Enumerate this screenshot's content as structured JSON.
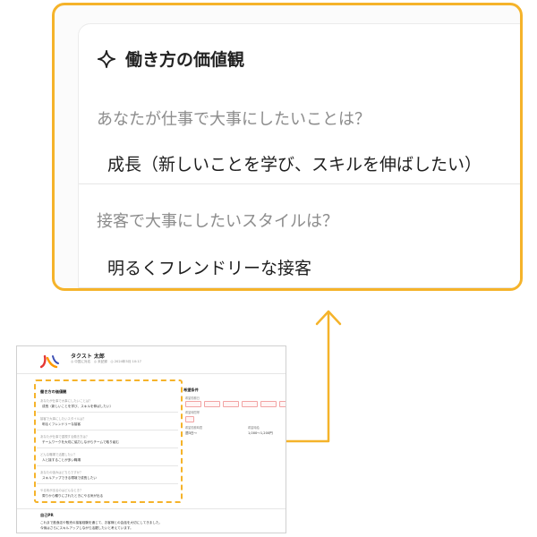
{
  "zoom": {
    "title": "働き方の価値観",
    "icon": "sparkle-icon",
    "q1": "あなたが仕事で大事にしたいことは？",
    "a1": "成長（新しいことを学び、スキルを伸ばしたい）",
    "q2": "接客で大事にしたいスタイルは？",
    "a2": "明るくフレンドリーな接客"
  },
  "thumb": {
    "name": "タクスト 太郎",
    "meta": "◎ 中国に対応　◎ 未記録　◎ 2024年5月 10:17",
    "values": {
      "title": "働き方の価値観",
      "qa": [
        {
          "q": "あなたが仕事で大事にしたいことは？",
          "a": "成長（新しいことを学び、スキルを伸ばしたい）"
        },
        {
          "q": "接客で大事にしたいスタイルは？",
          "a": "明るくフレンドリーな接客"
        },
        {
          "q": "あなたが仕事で重視する働き方は？",
          "a": "チームワークを大切に協力しながらチームで取り組む"
        },
        {
          "q": "どんな職場で活躍したい？",
          "a": "人と接することが多い職場"
        },
        {
          "q": "あなたの強みはどちらですか？",
          "a": "スキルアップできる環境で成長したい"
        },
        {
          "q": "やる気が出るのはどんなとき？",
          "a": "周りから頼りにされたときにやる気が出る"
        }
      ]
    },
    "right": {
      "title": "希望条件",
      "label1": "希望勤務日",
      "label2": "希望時間帯",
      "label3": "希望勤務時間",
      "val3": "週3日〜",
      "label4": "希望時給",
      "val4": "1,000〜1,200円"
    },
    "bottom": {
      "title": "自己PR",
      "line1": "これまで飲食店や販売の接客経験を通じて、お客様との会話を大切にしてきました。",
      "line2": "今後はさらにスキルアップしながら活躍したいと考えています。"
    }
  },
  "colors": {
    "accent": "#f5b32a",
    "logo_red": "#e53935",
    "logo_blue": "#3f51b5",
    "logo_orange": "#ff9800"
  }
}
